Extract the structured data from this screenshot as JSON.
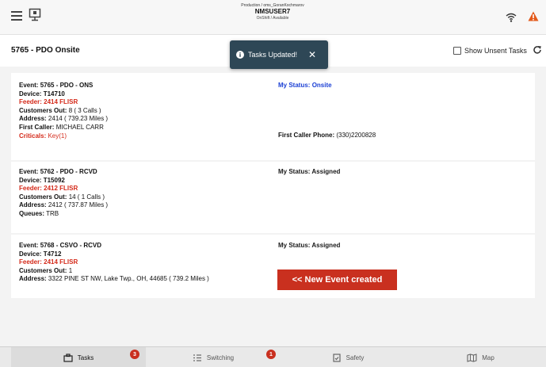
{
  "header": {
    "environment": "Production / oms_GoranKochmarov",
    "user": "NMSUSER7",
    "status": "OnShift / Available"
  },
  "subheader": {
    "title": "5765 - PDO Onsite",
    "show_unsent_label": "Show Unsent Tasks"
  },
  "toast": {
    "message": "Tasks Updated!",
    "close": "✕"
  },
  "tasks": [
    {
      "event": "5765 - PDO - ONS",
      "device": "T14710",
      "feeder": "2414 FLISR",
      "customers_out": "8 ( 3 Calls )",
      "address": "2414 ( 739.23 Miles )",
      "first_caller": "MICHAEL CARR",
      "criticals": "Key(1)",
      "my_status": "Onsite",
      "first_caller_phone": "(330)2200828"
    },
    {
      "event": "5762 - PDO - RCVD",
      "device": "T15092",
      "feeder": "2412 FLISR",
      "customers_out": "14 ( 1 Calls )",
      "address": "2412 ( 737.87 Miles )",
      "queues": "TRB",
      "my_status": "Assigned"
    },
    {
      "event": "5768 - CSVO - RCVD",
      "device": "T4712",
      "feeder": "2414 FLISR",
      "customers_out": "1",
      "address": "3322 PINE ST NW, Lake Twp., OH, 44685 ( 739.2 Miles )",
      "my_status": "Assigned"
    }
  ],
  "labels": {
    "event": "Event:",
    "device": "Device:",
    "feeder": "Feeder:",
    "customers_out": "Customers Out:",
    "address": "Address:",
    "first_caller": "First Caller:",
    "criticals": "Criticals:",
    "queues": "Queues:",
    "my_status": "My Status:",
    "first_caller_phone": "First Caller Phone:"
  },
  "annotation": {
    "new_event": "<< New Event created"
  },
  "nav": {
    "tasks": "Tasks",
    "tasks_badge": "3",
    "switching": "Switching",
    "switching_badge": "1",
    "safety": "Safety",
    "map": "Map"
  },
  "colors": {
    "feeder_red": "#d42a1a",
    "status_blue": "#1a3fd4",
    "toast_bg": "#2e4756",
    "badge_red": "#c9301f"
  },
  "icons": [
    "menu-icon",
    "device-icon",
    "wifi-icon",
    "warning-icon",
    "refresh-icon",
    "info-icon",
    "close-icon",
    "tasks-icon",
    "switching-icon",
    "safety-icon",
    "map-icon"
  ]
}
